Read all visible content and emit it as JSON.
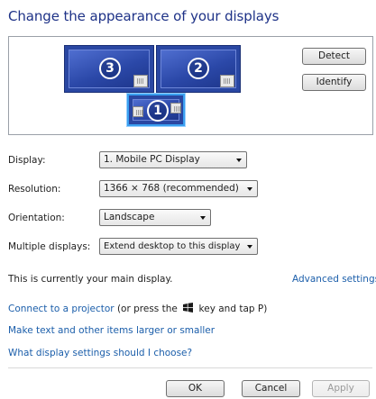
{
  "title": "Change the appearance of your displays",
  "monitors": [
    {
      "number": "3"
    },
    {
      "number": "2"
    },
    {
      "number": "1"
    }
  ],
  "buttons": {
    "detect": "Detect",
    "identify": "Identify",
    "ok": "OK",
    "cancel": "Cancel",
    "apply": "Apply"
  },
  "fields": {
    "display": {
      "label": "Display:",
      "value": "1. Mobile PC Display"
    },
    "resolution": {
      "label": "Resolution:",
      "value": "1366 × 768 (recommended)"
    },
    "orientation": {
      "label": "Orientation:",
      "value": "Landscape"
    },
    "multiple": {
      "label": "Multiple displays:",
      "value": "Extend desktop to this display"
    }
  },
  "main_display_text": "This is currently your main display.",
  "advanced_link": "Advanced settings",
  "projector": {
    "link": "Connect to a projector",
    "text_before": "(or press the",
    "text_after": "key and tap P)"
  },
  "links": {
    "text_size": "Make text and other items larger or smaller",
    "which_settings": "What display settings should I choose?"
  },
  "colors": {
    "title": "#1e3287",
    "link": "#1b5eaa",
    "monitor": "#2a47a2"
  }
}
